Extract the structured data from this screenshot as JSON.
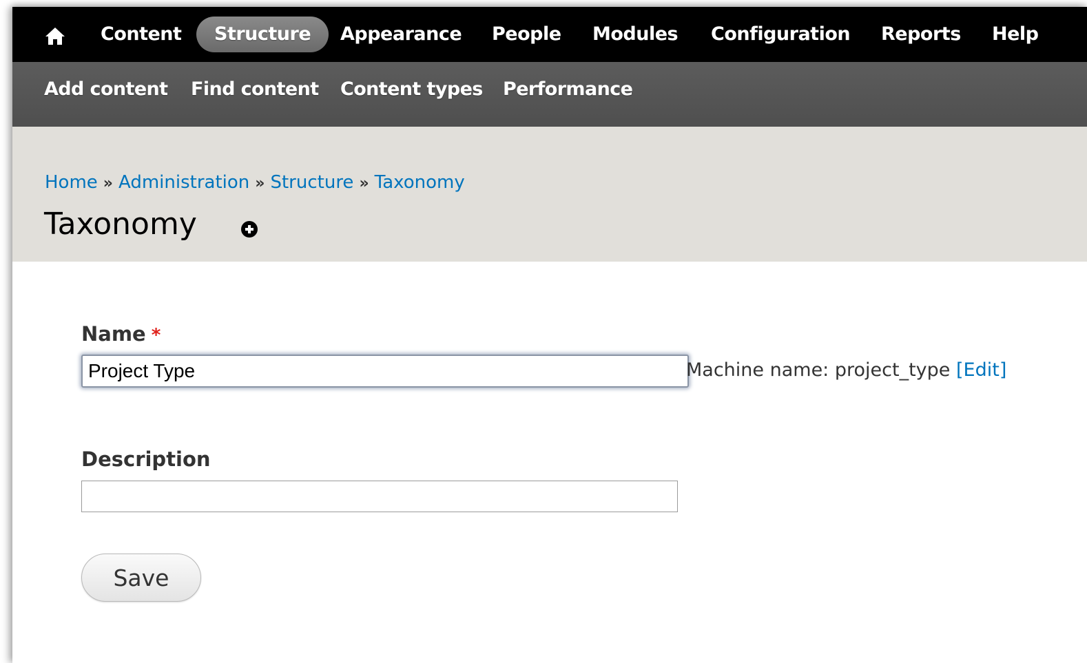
{
  "toolbar": {
    "home_icon": "home-icon",
    "items": [
      {
        "label": "Content",
        "active": false
      },
      {
        "label": "Structure",
        "active": true
      },
      {
        "label": "Appearance",
        "active": false
      },
      {
        "label": "People",
        "active": false
      },
      {
        "label": "Modules",
        "active": false
      },
      {
        "label": "Configuration",
        "active": false
      },
      {
        "label": "Reports",
        "active": false
      },
      {
        "label": "Help",
        "active": false
      }
    ]
  },
  "shortcuts": {
    "items": [
      {
        "label": "Add content"
      },
      {
        "label": "Find content"
      },
      {
        "label": "Content types"
      },
      {
        "label": "Performance"
      }
    ]
  },
  "breadcrumb": {
    "items": [
      "Home",
      "Administration",
      "Structure",
      "Taxonomy"
    ],
    "separator": "»"
  },
  "page": {
    "title": "Taxonomy",
    "shortcut_icon": "add-shortcut-icon"
  },
  "form": {
    "name": {
      "label": "Name",
      "required_marker": "*",
      "value": "Project Type",
      "machine_name_label": "Machine name: project_type",
      "edit_open": "[",
      "edit_label": "Edit",
      "edit_close": "]"
    },
    "description": {
      "label": "Description",
      "value": ""
    },
    "save_label": "Save"
  },
  "colors": {
    "link": "#0074bd",
    "required": "#e0221c",
    "toolbar_bg": "#000000",
    "subbar_bg": "#555555",
    "header_bg": "#e1dfda"
  }
}
